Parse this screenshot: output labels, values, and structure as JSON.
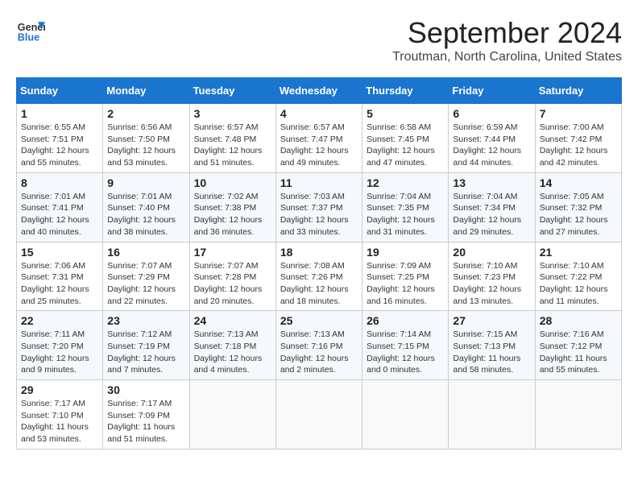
{
  "header": {
    "logo_line1": "General",
    "logo_line2": "Blue",
    "month": "September 2024",
    "location": "Troutman, North Carolina, United States"
  },
  "weekdays": [
    "Sunday",
    "Monday",
    "Tuesday",
    "Wednesday",
    "Thursday",
    "Friday",
    "Saturday"
  ],
  "weeks": [
    [
      {
        "day": "1",
        "info": "Sunrise: 6:55 AM\nSunset: 7:51 PM\nDaylight: 12 hours\nand 55 minutes."
      },
      {
        "day": "2",
        "info": "Sunrise: 6:56 AM\nSunset: 7:50 PM\nDaylight: 12 hours\nand 53 minutes."
      },
      {
        "day": "3",
        "info": "Sunrise: 6:57 AM\nSunset: 7:48 PM\nDaylight: 12 hours\nand 51 minutes."
      },
      {
        "day": "4",
        "info": "Sunrise: 6:57 AM\nSunset: 7:47 PM\nDaylight: 12 hours\nand 49 minutes."
      },
      {
        "day": "5",
        "info": "Sunrise: 6:58 AM\nSunset: 7:45 PM\nDaylight: 12 hours\nand 47 minutes."
      },
      {
        "day": "6",
        "info": "Sunrise: 6:59 AM\nSunset: 7:44 PM\nDaylight: 12 hours\nand 44 minutes."
      },
      {
        "day": "7",
        "info": "Sunrise: 7:00 AM\nSunset: 7:42 PM\nDaylight: 12 hours\nand 42 minutes."
      }
    ],
    [
      {
        "day": "8",
        "info": "Sunrise: 7:01 AM\nSunset: 7:41 PM\nDaylight: 12 hours\nand 40 minutes."
      },
      {
        "day": "9",
        "info": "Sunrise: 7:01 AM\nSunset: 7:40 PM\nDaylight: 12 hours\nand 38 minutes."
      },
      {
        "day": "10",
        "info": "Sunrise: 7:02 AM\nSunset: 7:38 PM\nDaylight: 12 hours\nand 36 minutes."
      },
      {
        "day": "11",
        "info": "Sunrise: 7:03 AM\nSunset: 7:37 PM\nDaylight: 12 hours\nand 33 minutes."
      },
      {
        "day": "12",
        "info": "Sunrise: 7:04 AM\nSunset: 7:35 PM\nDaylight: 12 hours\nand 31 minutes."
      },
      {
        "day": "13",
        "info": "Sunrise: 7:04 AM\nSunset: 7:34 PM\nDaylight: 12 hours\nand 29 minutes."
      },
      {
        "day": "14",
        "info": "Sunrise: 7:05 AM\nSunset: 7:32 PM\nDaylight: 12 hours\nand 27 minutes."
      }
    ],
    [
      {
        "day": "15",
        "info": "Sunrise: 7:06 AM\nSunset: 7:31 PM\nDaylight: 12 hours\nand 25 minutes."
      },
      {
        "day": "16",
        "info": "Sunrise: 7:07 AM\nSunset: 7:29 PM\nDaylight: 12 hours\nand 22 minutes."
      },
      {
        "day": "17",
        "info": "Sunrise: 7:07 AM\nSunset: 7:28 PM\nDaylight: 12 hours\nand 20 minutes."
      },
      {
        "day": "18",
        "info": "Sunrise: 7:08 AM\nSunset: 7:26 PM\nDaylight: 12 hours\nand 18 minutes."
      },
      {
        "day": "19",
        "info": "Sunrise: 7:09 AM\nSunset: 7:25 PM\nDaylight: 12 hours\nand 16 minutes."
      },
      {
        "day": "20",
        "info": "Sunrise: 7:10 AM\nSunset: 7:23 PM\nDaylight: 12 hours\nand 13 minutes."
      },
      {
        "day": "21",
        "info": "Sunrise: 7:10 AM\nSunset: 7:22 PM\nDaylight: 12 hours\nand 11 minutes."
      }
    ],
    [
      {
        "day": "22",
        "info": "Sunrise: 7:11 AM\nSunset: 7:20 PM\nDaylight: 12 hours\nand 9 minutes."
      },
      {
        "day": "23",
        "info": "Sunrise: 7:12 AM\nSunset: 7:19 PM\nDaylight: 12 hours\nand 7 minutes."
      },
      {
        "day": "24",
        "info": "Sunrise: 7:13 AM\nSunset: 7:18 PM\nDaylight: 12 hours\nand 4 minutes."
      },
      {
        "day": "25",
        "info": "Sunrise: 7:13 AM\nSunset: 7:16 PM\nDaylight: 12 hours\nand 2 minutes."
      },
      {
        "day": "26",
        "info": "Sunrise: 7:14 AM\nSunset: 7:15 PM\nDaylight: 12 hours\nand 0 minutes."
      },
      {
        "day": "27",
        "info": "Sunrise: 7:15 AM\nSunset: 7:13 PM\nDaylight: 11 hours\nand 58 minutes."
      },
      {
        "day": "28",
        "info": "Sunrise: 7:16 AM\nSunset: 7:12 PM\nDaylight: 11 hours\nand 55 minutes."
      }
    ],
    [
      {
        "day": "29",
        "info": "Sunrise: 7:17 AM\nSunset: 7:10 PM\nDaylight: 11 hours\nand 53 minutes."
      },
      {
        "day": "30",
        "info": "Sunrise: 7:17 AM\nSunset: 7:09 PM\nDaylight: 11 hours\nand 51 minutes."
      },
      {
        "day": "",
        "info": ""
      },
      {
        "day": "",
        "info": ""
      },
      {
        "day": "",
        "info": ""
      },
      {
        "day": "",
        "info": ""
      },
      {
        "day": "",
        "info": ""
      }
    ]
  ]
}
